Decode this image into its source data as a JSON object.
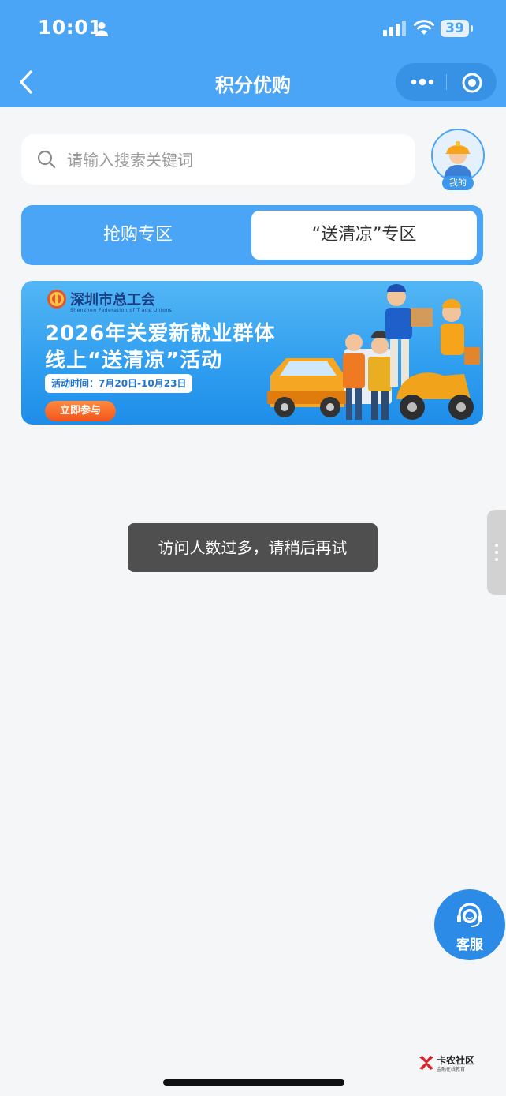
{
  "status_bar": {
    "time": "10:01",
    "battery": "39"
  },
  "header": {
    "title": "积分优购"
  },
  "search": {
    "placeholder": "请输入搜索关键词"
  },
  "profile": {
    "badge": "我的"
  },
  "tabs": [
    {
      "label": "抢购专区",
      "active": false
    },
    {
      "label": "“送清凉”专区",
      "active": true
    }
  ],
  "banner": {
    "org": "深圳市总工会",
    "org_en": "Shenzhen Federation of Trade Unions",
    "line1": "2026年关爱新就业群体",
    "line2": "线上“送清凉”活动",
    "date": "活动时间：7月20日-10月23日",
    "cta": "立即参与"
  },
  "toast": {
    "message": "访问人数过多，请稍后再试"
  },
  "customer_service": {
    "label": "客服"
  },
  "watermark": {
    "title": "卡农社区",
    "subtitle": "金融在线教育"
  },
  "colors": {
    "primary": "#4aa5f7",
    "cta_orange": "#f2541c"
  }
}
